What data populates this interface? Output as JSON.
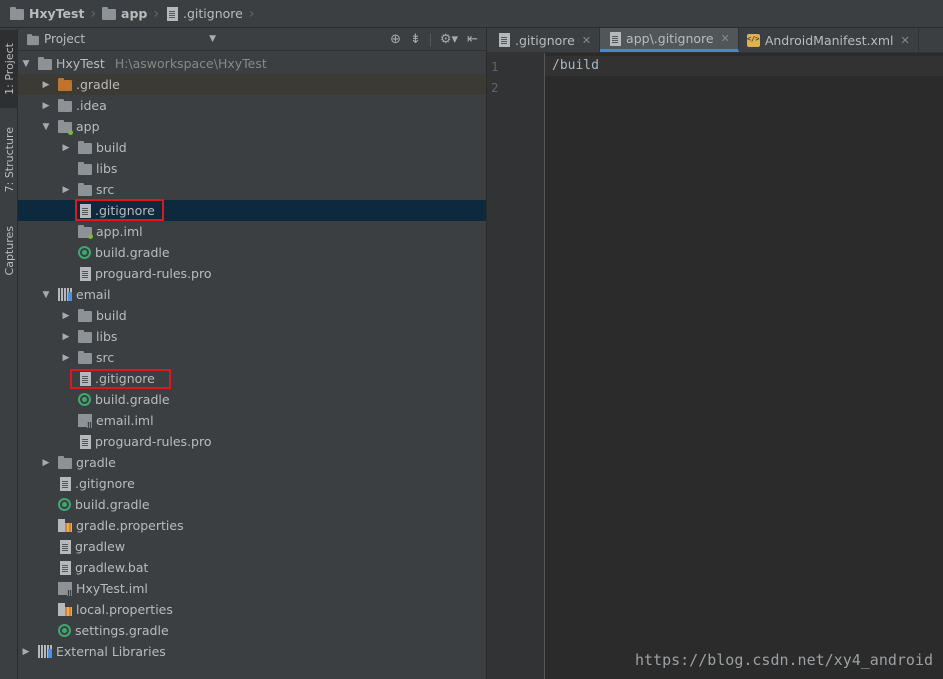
{
  "navbar": {
    "crumbs": [
      {
        "label": "HxyTest",
        "icon": "project-folder-icon",
        "bold": true
      },
      {
        "label": "app",
        "icon": "module-folder-icon",
        "bold": true
      },
      {
        "label": ".gitignore",
        "icon": "file-icon",
        "bold": false
      }
    ]
  },
  "stripe": {
    "tabs": [
      "1: Project",
      "7: Structure",
      "Captures"
    ]
  },
  "project_panel": {
    "view_selector": "Project",
    "tools": [
      "target-icon",
      "collapse-icon",
      "gear-icon",
      "hide-icon"
    ]
  },
  "tree": [
    {
      "label": "HxyTest",
      "path": "H:\\asworkspace\\HxyTest",
      "depth": 0,
      "arrow": "down",
      "icon": "folder"
    },
    {
      "label": ".gradle",
      "depth": 1,
      "arrow": "right",
      "icon": "folder-orange"
    },
    {
      "label": ".idea",
      "depth": 1,
      "arrow": "right",
      "icon": "folder"
    },
    {
      "label": "app",
      "depth": 1,
      "arrow": "down",
      "icon": "module"
    },
    {
      "label": "build",
      "depth": 2,
      "arrow": "right",
      "icon": "folder"
    },
    {
      "label": "libs",
      "depth": 2,
      "arrow": "none",
      "icon": "folder"
    },
    {
      "label": "src",
      "depth": 2,
      "arrow": "right",
      "icon": "folder"
    },
    {
      "label": ".gitignore",
      "depth": 2,
      "arrow": "none",
      "icon": "file",
      "selected": true
    },
    {
      "label": "app.iml",
      "depth": 2,
      "arrow": "none",
      "icon": "android"
    },
    {
      "label": "build.gradle",
      "depth": 2,
      "arrow": "none",
      "icon": "gradle"
    },
    {
      "label": "proguard-rules.pro",
      "depth": 2,
      "arrow": "none",
      "icon": "file"
    },
    {
      "label": "email",
      "depth": 1,
      "arrow": "down",
      "icon": "lib"
    },
    {
      "label": "build",
      "depth": 2,
      "arrow": "right",
      "icon": "folder"
    },
    {
      "label": "libs",
      "depth": 2,
      "arrow": "right",
      "icon": "folder"
    },
    {
      "label": "src",
      "depth": 2,
      "arrow": "right",
      "icon": "folder"
    },
    {
      "label": ".gitignore",
      "depth": 2,
      "arrow": "none",
      "icon": "file"
    },
    {
      "label": "build.gradle",
      "depth": 2,
      "arrow": "none",
      "icon": "gradle"
    },
    {
      "label": "email.iml",
      "depth": 2,
      "arrow": "none",
      "icon": "iml"
    },
    {
      "label": "proguard-rules.pro",
      "depth": 2,
      "arrow": "none",
      "icon": "file"
    },
    {
      "label": "gradle",
      "depth": 1,
      "arrow": "right",
      "icon": "folder"
    },
    {
      "label": ".gitignore",
      "depth": 1,
      "arrow": "none",
      "icon": "file"
    },
    {
      "label": "build.gradle",
      "depth": 1,
      "arrow": "none",
      "icon": "gradle"
    },
    {
      "label": "gradle.properties",
      "depth": 1,
      "arrow": "none",
      "icon": "props"
    },
    {
      "label": "gradlew",
      "depth": 1,
      "arrow": "none",
      "icon": "file"
    },
    {
      "label": "gradlew.bat",
      "depth": 1,
      "arrow": "none",
      "icon": "file"
    },
    {
      "label": "HxyTest.iml",
      "depth": 1,
      "arrow": "none",
      "icon": "iml"
    },
    {
      "label": "local.properties",
      "depth": 1,
      "arrow": "none",
      "icon": "props"
    },
    {
      "label": "settings.gradle",
      "depth": 1,
      "arrow": "none",
      "icon": "gradle"
    },
    {
      "label": "External Libraries",
      "depth": 0,
      "arrow": "right",
      "icon": "lib"
    }
  ],
  "editor": {
    "tabs": [
      {
        "label": ".gitignore",
        "icon": "file",
        "closable": true,
        "active": false
      },
      {
        "label": "app\\.gitignore",
        "icon": "file",
        "closable": true,
        "active": true
      },
      {
        "label": "AndroidManifest.xml",
        "icon": "xml",
        "closable": true,
        "active": false
      }
    ],
    "line_numbers": [
      "1",
      "2"
    ],
    "lines": [
      "/build",
      ""
    ]
  },
  "watermark": "https://blog.csdn.net/xy4_android",
  "colors": {
    "highlight_box": "#e0161b",
    "selection": "#0d293e",
    "active_tab_underline": "#4a88c7"
  }
}
